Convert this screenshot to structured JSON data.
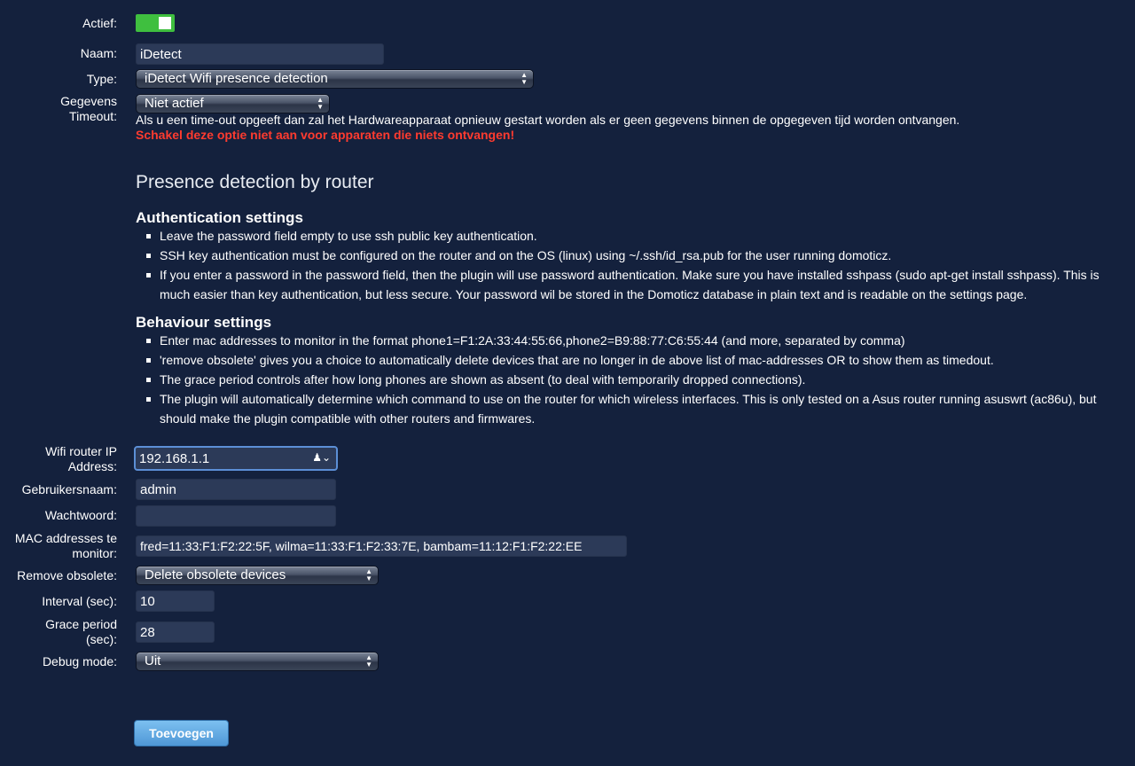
{
  "form": {
    "active_label": "Actief:",
    "name_label": "Naam:",
    "name_value": "iDetect",
    "type_label": "Type:",
    "type_value": "iDetect Wifi presence detection",
    "timeout_label_1": "Gegevens",
    "timeout_label_2": "Timeout:",
    "timeout_value": "Niet actief",
    "timeout_help": "Als u een time-out opgeeft dan zal het Hardwareapparaat opnieuw gestart worden als er geen gegevens binnen de opgegeven tijd worden ontvangen.",
    "timeout_warning": "Schakel deze optie niet aan voor apparaten die niets ontvangen!"
  },
  "plugin": {
    "title": "Presence detection by router",
    "auth_heading": "Authentication settings",
    "auth_items": [
      "Leave the password field empty to use ssh public key authentication.",
      "SSH key authentication must be configured on the router and on the OS (linux) using ~/.ssh/id_rsa.pub for the user running domoticz.",
      "If you enter a password in the password field, then the plugin will use password authentication. Make sure you have installed sshpass (sudo apt-get install sshpass). This is much easier than key authentication, but less secure. Your password wil be stored in the Domoticz database in plain text and is readable on the settings page."
    ],
    "behaviour_heading": "Behaviour settings",
    "behaviour_items": [
      "Enter mac addresses to monitor in the format phone1=F1:2A:33:44:55:66,phone2=B9:88:77:C6:55:44 (and more, separated by comma)",
      "'remove obsolete' gives you a choice to automatically delete devices that are no longer in de above list of mac-addresses OR to show them as timedout.",
      "The grace period controls after how long phones are shown as absent (to deal with temporarily dropped connections).",
      "The plugin will automatically determine which command to use on the router for which wireless interfaces. This is only tested on a Asus router running asuswrt (ac86u), but should make the plugin compatible with other routers and firmwares."
    ]
  },
  "params": {
    "ip_label_1": "Wifi router IP",
    "ip_label_2": "Address:",
    "ip_value": "192.168.1.1",
    "user_label": "Gebruikersnaam:",
    "user_value": "admin",
    "password_label": "Wachtwoord:",
    "password_value": "",
    "mac_label_1": "MAC addresses te",
    "mac_label_2": "monitor:",
    "mac_value": "fred=11:33:F1:F2:22:5F, wilma=11:33:F1:F2:33:7E, bambam=11:12:F1:F2:22:EE",
    "remove_label": "Remove obsolete:",
    "remove_value": "Delete obsolete devices",
    "interval_label": "Interval (sec):",
    "interval_value": "10",
    "grace_label_1": "Grace period",
    "grace_label_2": "(sec):",
    "grace_value": "28",
    "debug_label": "Debug mode:",
    "debug_value": "Uit"
  },
  "actions": {
    "add_label": "Toevoegen"
  },
  "colors": {
    "background": "#14213d",
    "toggle_on": "#3fbf3f",
    "warning": "#ff3b2f",
    "button": "#5fa8e0"
  }
}
